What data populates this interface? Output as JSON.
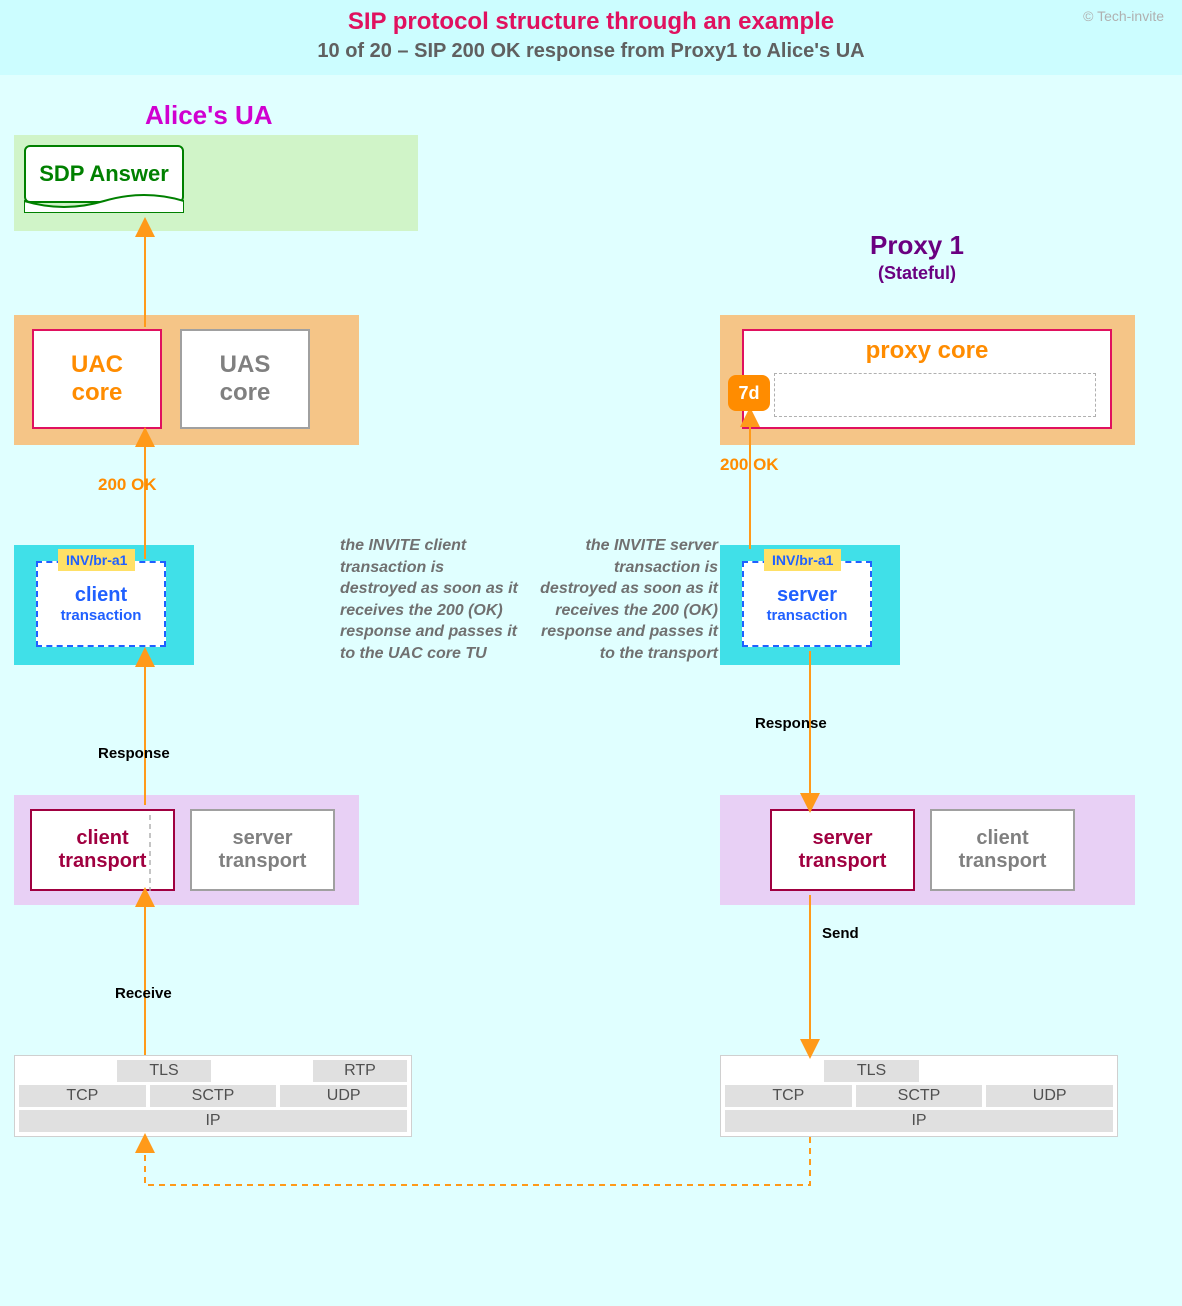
{
  "header": {
    "title": "SIP protocol structure through an example",
    "subtitle": "10 of 20 – SIP 200 OK response from Proxy1 to Alice's UA",
    "credit": "© Tech-invite"
  },
  "left": {
    "label": "Alice's UA",
    "sdp": "SDP Answer",
    "uac_l1": "UAC",
    "uac_l2": "core",
    "uas_l1": "UAS",
    "uas_l2": "core",
    "txn_badge": "INV/br-a1",
    "txn_l1": "client",
    "txn_l2": "transaction",
    "trans_client_l1": "client",
    "trans_client_l2": "transport",
    "trans_server_l1": "server",
    "trans_server_l2": "transport",
    "note": "the INVITE client transaction is destroyed as soon as it receives the 200 (OK) response and passes it to the UAC core TU"
  },
  "right": {
    "label": "Proxy 1",
    "sublabel": "(Stateful)",
    "proxy_core": "proxy core",
    "badge7d": "7d",
    "txn_badge": "INV/br-a1",
    "txn_l1": "server",
    "txn_l2": "transaction",
    "trans_server_l1": "server",
    "trans_server_l2": "transport",
    "trans_client_l1": "client",
    "trans_client_l2": "transport",
    "note": "the INVITE server transaction is destroyed as soon as it receives the 200 (OK) response and passes it to the transport"
  },
  "arrows": {
    "ok_left": "200 OK",
    "ok_right": "200 OK",
    "response_l": "Response",
    "response_r": "Response",
    "receive": "Receive",
    "send": "Send"
  },
  "net": {
    "tls": "TLS",
    "rtp": "RTP",
    "tcp": "TCP",
    "sctp": "SCTP",
    "udp": "UDP",
    "ip": "IP"
  }
}
